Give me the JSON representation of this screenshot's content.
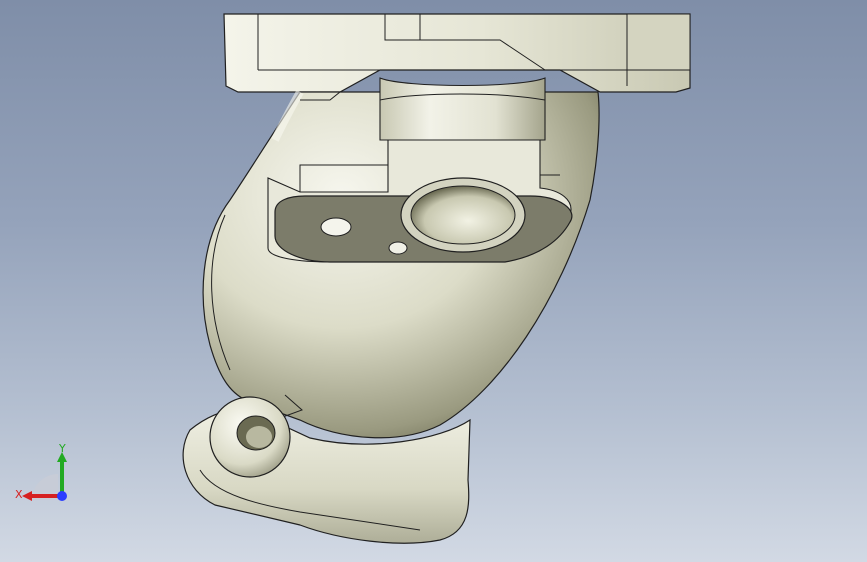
{
  "triad": {
    "x_label": "X",
    "y_label": "Y",
    "x_color": "#d62020",
    "y_color": "#22aa22",
    "z_color": "#2a3cff"
  },
  "model": {
    "shade_light": "#f3f3e8",
    "shade_mid": "#d9d9c4",
    "shade_dark": "#5f5f44",
    "flange_face": "#7c7c6a",
    "edge": "#202020"
  }
}
